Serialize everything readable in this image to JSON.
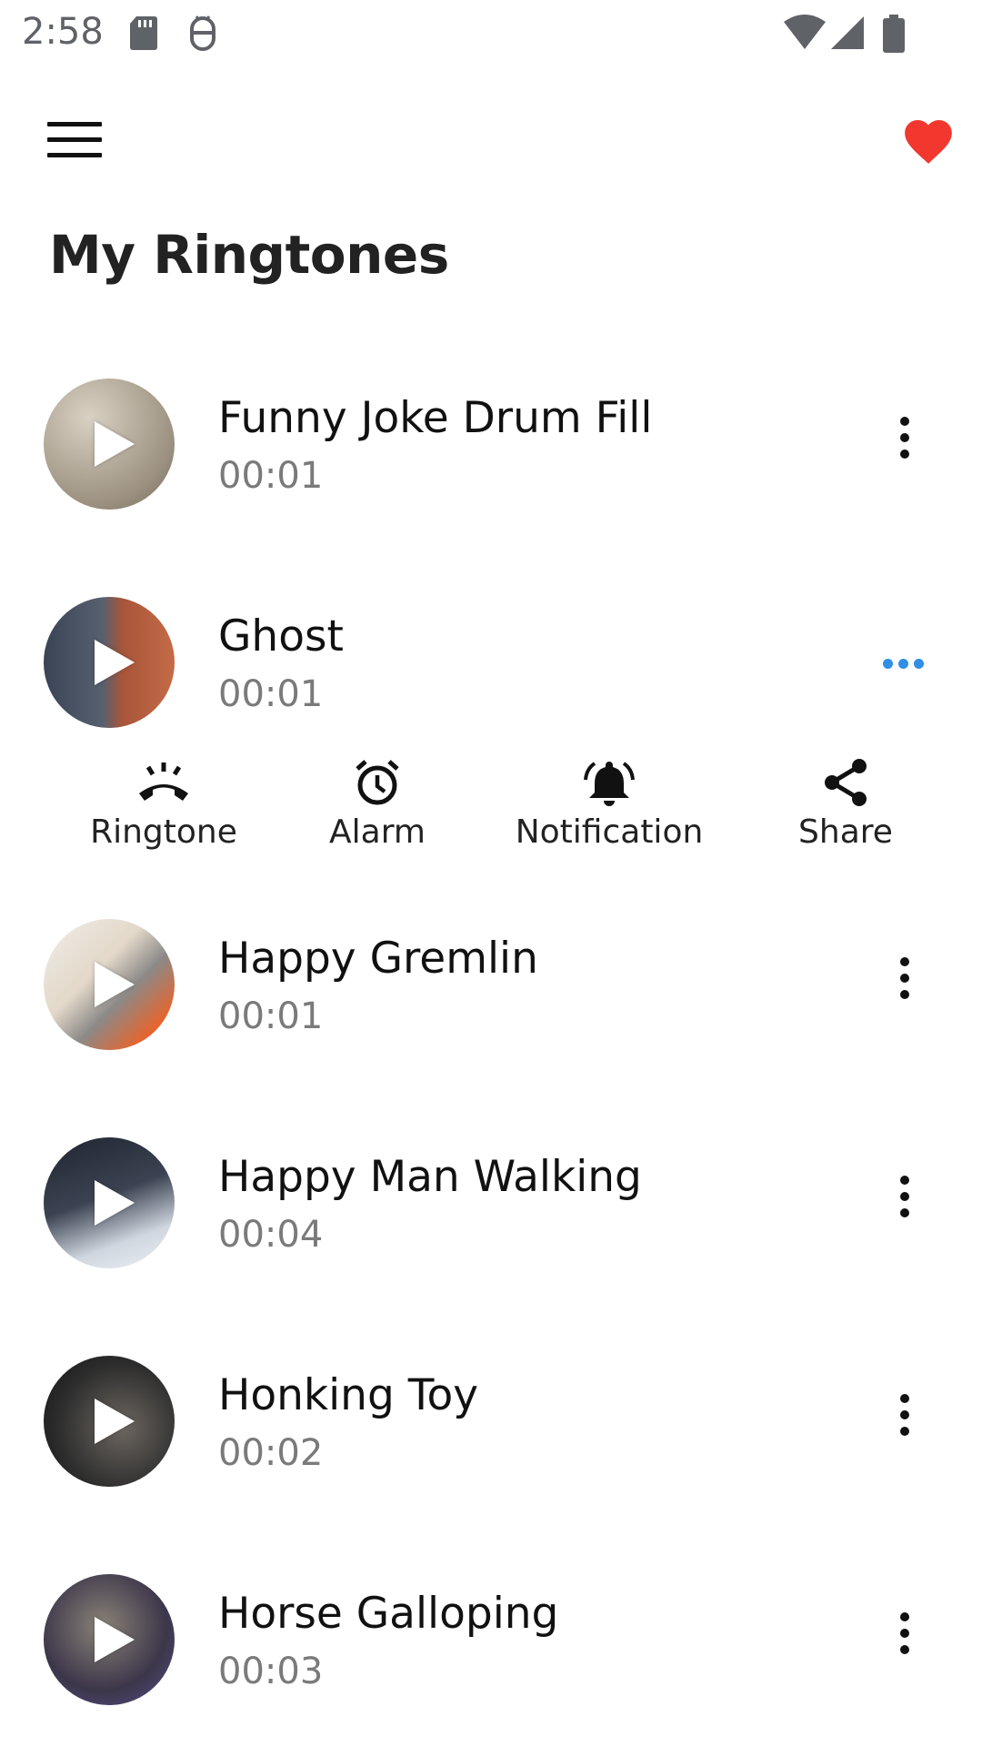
{
  "status_bar": {
    "time": "2:58",
    "icons": [
      "sd-card-icon",
      "android-debug-icon",
      "wifi-icon",
      "cellular-signal-icon",
      "battery-icon"
    ]
  },
  "app_bar": {
    "menu_icon": "hamburger-menu-icon",
    "favorite_icon": "heart-icon",
    "favorite_color": "#f2372f"
  },
  "page": {
    "title": "My Ringtones"
  },
  "ringtones": [
    {
      "title": "Funny Joke Drum Fill",
      "duration": "00:01",
      "thumb": [
        "#c9c0b1",
        "#8e8579"
      ]
    },
    {
      "title": "Ghost",
      "duration": "00:01",
      "thumb": [
        "#b55a3d",
        "#3c4a5e"
      ]
    },
    {
      "title": "Happy Gremlin",
      "duration": "00:01",
      "thumb": [
        "#e6e2dc",
        "#e2662c"
      ]
    },
    {
      "title": "Happy Man Walking",
      "duration": "00:04",
      "thumb": [
        "#2c3441",
        "#d7dde6"
      ]
    },
    {
      "title": "Honking Toy",
      "duration": "00:02",
      "thumb": [
        "#3a3a3a",
        "#1a1a1a"
      ]
    },
    {
      "title": "Horse Galloping",
      "duration": "00:03",
      "thumb": [
        "#2e2a3a",
        "#5c5670"
      ]
    }
  ],
  "actions": {
    "ringtone": {
      "label": "Ringtone",
      "icon": "phone-ring-icon"
    },
    "alarm": {
      "label": "Alarm",
      "icon": "alarm-clock-icon"
    },
    "notification": {
      "label": "Notification",
      "icon": "bell-ring-icon"
    },
    "share": {
      "label": "Share",
      "icon": "share-icon"
    }
  },
  "accent_color": "#2f8fe6"
}
